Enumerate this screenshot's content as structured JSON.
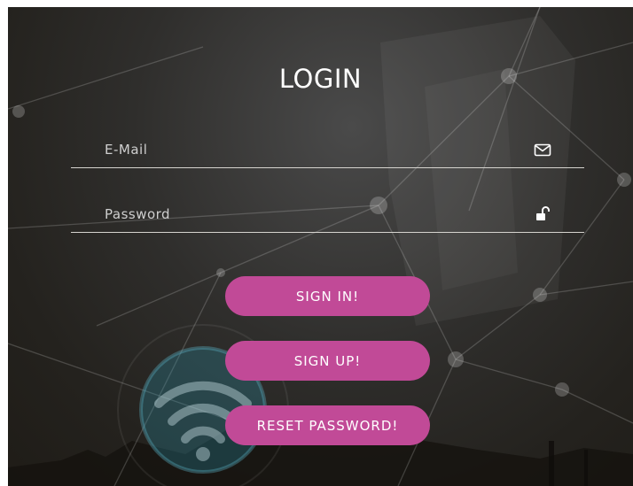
{
  "login": {
    "title": "LOGIN",
    "email": {
      "placeholder": "E-Mail",
      "value": "",
      "icon": "envelope-icon"
    },
    "password": {
      "placeholder": "Password",
      "value": "",
      "icon": "unlock-icon"
    },
    "buttons": {
      "sign_in": "SIGN IN!",
      "sign_up": "SIGN UP!",
      "reset_password": "RESET PASSWORD!"
    }
  },
  "colors": {
    "accent": "#c14a97",
    "text": "#ffffff",
    "underline": "#d6d4cf"
  }
}
